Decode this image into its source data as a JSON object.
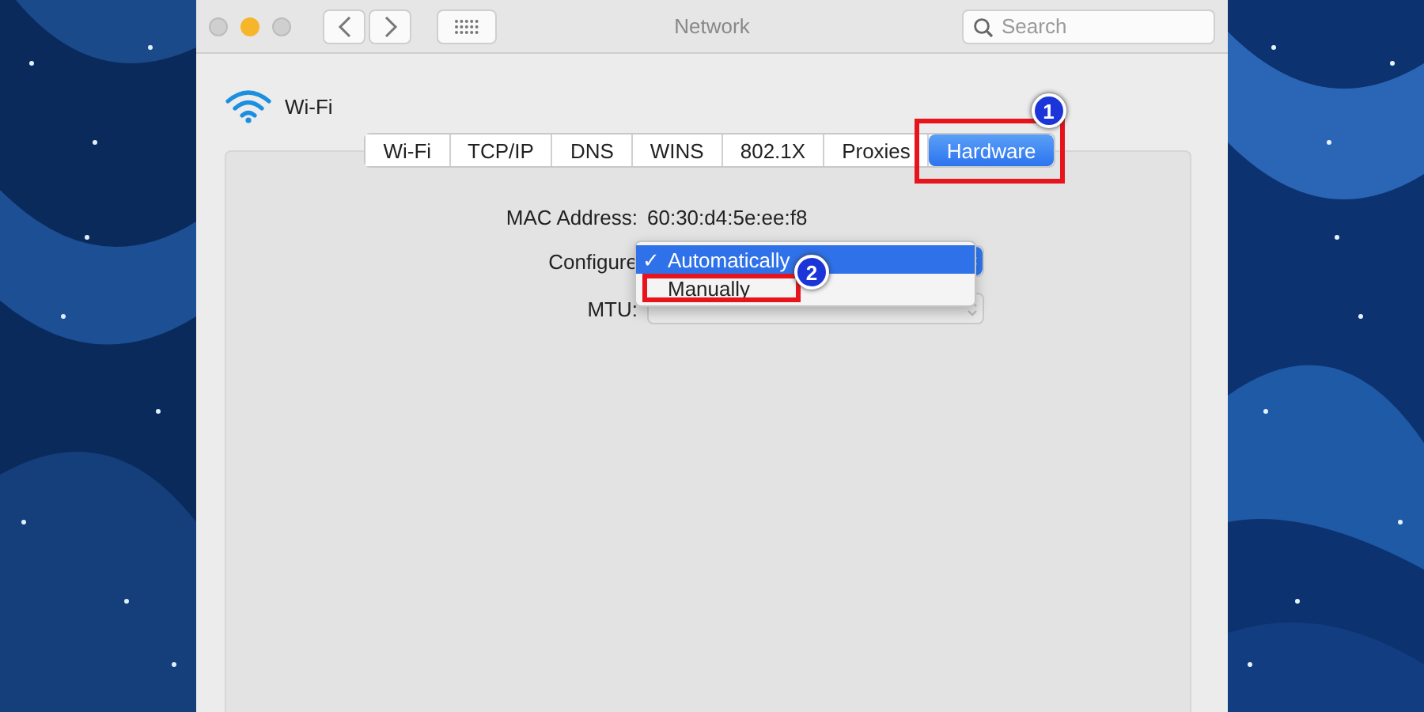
{
  "window": {
    "title": "Network"
  },
  "search": {
    "placeholder": "Search"
  },
  "interface": {
    "name": "Wi-Fi"
  },
  "tabs": [
    {
      "label": "Wi-Fi",
      "selected": false
    },
    {
      "label": "TCP/IP",
      "selected": false
    },
    {
      "label": "DNS",
      "selected": false
    },
    {
      "label": "WINS",
      "selected": false
    },
    {
      "label": "802.1X",
      "selected": false
    },
    {
      "label": "Proxies",
      "selected": false
    },
    {
      "label": "Hardware",
      "selected": true,
      "annotation": "1"
    }
  ],
  "fields": [
    {
      "label": "MAC Address:",
      "value": "60:30:d4:5e:ee:f8",
      "kind": "text"
    },
    {
      "label": "Configure",
      "kind": "popup",
      "disabled": false
    },
    {
      "label": "MTU:",
      "kind": "popup",
      "disabled": true
    }
  ],
  "configure_menu": [
    {
      "check": "✓",
      "label": "Automatically",
      "selected": true
    },
    {
      "label": "Manually",
      "selected": false,
      "annotation": "2"
    }
  ]
}
